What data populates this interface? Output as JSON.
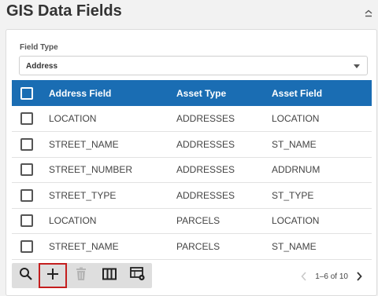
{
  "header": {
    "title": "GIS Data Fields",
    "collapse_icon": "chevron-up-icon"
  },
  "filter": {
    "label": "Field Type",
    "selected": "Address"
  },
  "table": {
    "columns": [
      "Address Field",
      "Asset Type",
      "Asset Field"
    ],
    "rows": [
      [
        "LOCATION",
        "ADDRESSES",
        "LOCATION"
      ],
      [
        "STREET_NAME",
        "ADDRESSES",
        "ST_NAME"
      ],
      [
        "STREET_NUMBER",
        "ADDRESSES",
        "ADDRNUM"
      ],
      [
        "STREET_TYPE",
        "ADDRESSES",
        "ST_TYPE"
      ],
      [
        "LOCATION",
        "PARCELS",
        "LOCATION"
      ],
      [
        "STREET_NAME",
        "PARCELS",
        "ST_NAME"
      ]
    ]
  },
  "toolbar": {
    "icons": [
      "search-icon",
      "add-icon",
      "delete-icon",
      "columns-icon",
      "grid-settings-icon"
    ],
    "highlight_color": "#c41e1e"
  },
  "pager": {
    "range_text": "1–6 of 10"
  },
  "colors": {
    "header_bg": "#1a6db3",
    "toolbar_bg": "#dedede"
  }
}
